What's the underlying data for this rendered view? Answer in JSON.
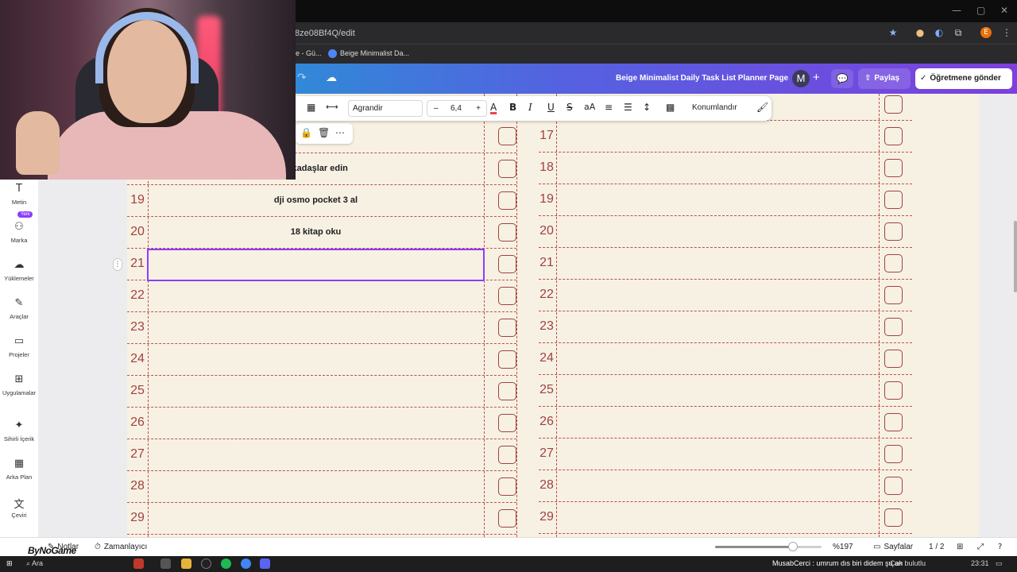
{
  "browser": {
    "url": "8ze08Bf4Q/edit",
    "bookmarks": [
      "e - Gü...",
      "Beige Minimalist Da..."
    ],
    "profile_initial": "E"
  },
  "header": {
    "doc_title": "Beige Minimalist Daily Task List Planner Page",
    "avatar_initial": "M",
    "share_label": "Paylaş",
    "teacher_label": "Öğretmene gönder"
  },
  "toolbar": {
    "font": "Agrandir",
    "size": "6,4",
    "minus": "–",
    "plus": "+",
    "position_label": "Konumlandır"
  },
  "sidebar": {
    "items": [
      {
        "label": "Metin",
        "icon": "text-icon"
      },
      {
        "label": "Marka",
        "icon": "brand-icon",
        "badge": "Yeni"
      },
      {
        "label": "Yüklemeler",
        "icon": "upload-icon"
      },
      {
        "label": "Araçlar",
        "icon": "draw-icon"
      },
      {
        "label": "Projeler",
        "icon": "folder-icon"
      },
      {
        "label": "Uygulamalar",
        "icon": "apps-icon"
      },
      {
        "label": "Sihirli İçerik",
        "icon": "magic-icon"
      },
      {
        "label": "Arka Plan",
        "icon": "background-icon"
      },
      {
        "label": "Çeviri",
        "icon": "translate-icon"
      }
    ]
  },
  "planner": {
    "left_column": {
      "rows": [
        {
          "num": "",
          "text": "arkadaşlar edin"
        },
        {
          "num": "19",
          "text": "dji osmo pocket 3 al"
        },
        {
          "num": "20",
          "text": "18 kitap oku"
        },
        {
          "num": "21",
          "text": ""
        },
        {
          "num": "22",
          "text": ""
        },
        {
          "num": "23",
          "text": ""
        },
        {
          "num": "24",
          "text": ""
        },
        {
          "num": "25",
          "text": ""
        },
        {
          "num": "26",
          "text": ""
        },
        {
          "num": "27",
          "text": ""
        },
        {
          "num": "28",
          "text": ""
        },
        {
          "num": "29",
          "text": ""
        }
      ]
    },
    "right_column": {
      "rows": [
        "17",
        "18",
        "19",
        "20",
        "21",
        "22",
        "23",
        "24",
        "25",
        "26",
        "27",
        "28",
        "29"
      ]
    }
  },
  "footer": {
    "notes_label": "Notlar",
    "timer_label": "Zamanlayıcı",
    "zoom": "%197",
    "zoom_level": 0.73,
    "pages_label": "Sayfalar",
    "page_count": "1 / 2",
    "watermark": "ByNoGame"
  },
  "taskbar": {
    "search_label": "Ara",
    "notification": "MusabCerci : umrum dıs biri didem şu an",
    "weather": "Çok bulutlu",
    "clock": "23:31"
  },
  "colors": {
    "accent": "#8b3dff",
    "planner_line": "#c0504d",
    "planner_bg": "#f7f1e3"
  }
}
